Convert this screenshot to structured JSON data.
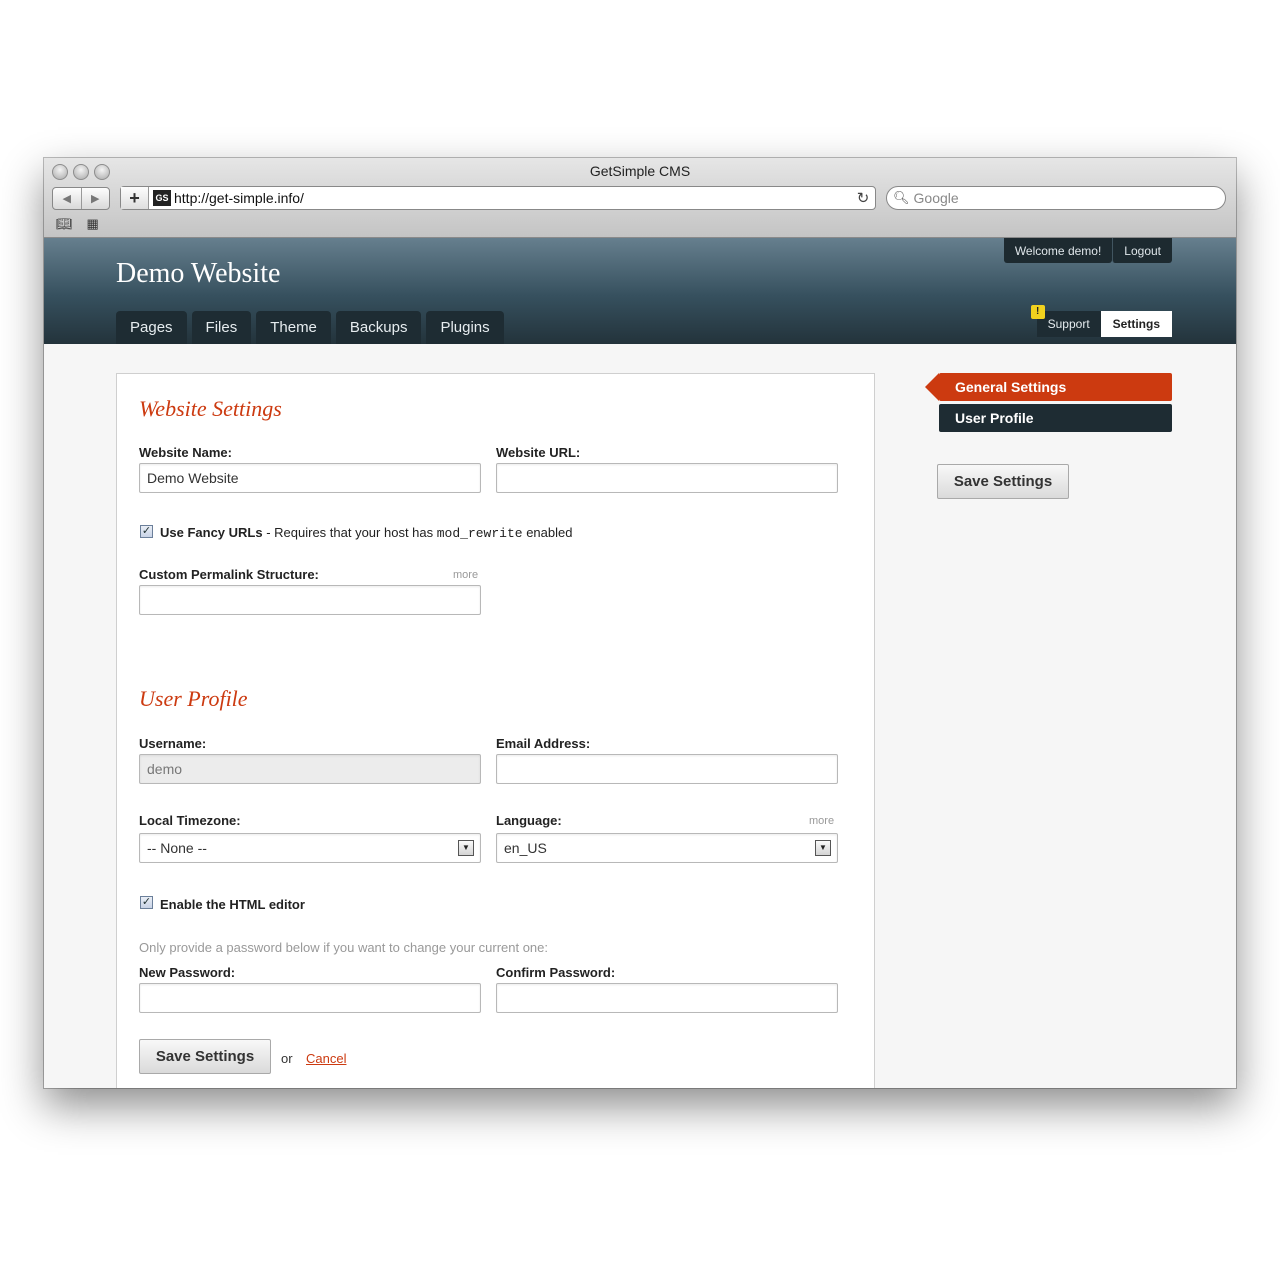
{
  "browser": {
    "window_title": "GetSimple CMS",
    "favicon_text": "GS",
    "url": "http://get-simple.info/",
    "search_placeholder": "Google"
  },
  "site": {
    "title": "Demo Website",
    "welcome": "Welcome demo!",
    "logout": "Logout",
    "tabs": [
      "Pages",
      "Files",
      "Theme",
      "Backups",
      "Plugins"
    ],
    "support": "Support",
    "support_alert": "!",
    "settings": "Settings"
  },
  "sidebar": {
    "items": [
      "General Settings",
      "User Profile"
    ],
    "save_label": "Save Settings"
  },
  "website_settings": {
    "heading": "Website Settings",
    "name_label": "Website Name:",
    "name_value": "Demo Website",
    "url_label": "Website URL:",
    "url_value": "",
    "fancy_label": "Use Fancy URLs",
    "fancy_note_pre": " - Requires that your host has ",
    "fancy_note_code": "mod_rewrite",
    "fancy_note_post": " enabled",
    "permalink_label": "Custom Permalink Structure:",
    "permalink_more": "more",
    "permalink_value": ""
  },
  "user_profile": {
    "heading": "User Profile",
    "username_label": "Username:",
    "username_value": "demo",
    "email_label": "Email Address:",
    "email_value": "",
    "timezone_label": "Local Timezone:",
    "timezone_value": "-- None --",
    "language_label": "Language:",
    "language_more": "more",
    "language_value": "en_US",
    "html_editor_label": "Enable the HTML editor",
    "password_hint": "Only provide a password below if you want to change your current one:",
    "new_password_label": "New Password:",
    "confirm_password_label": "Confirm Password:"
  },
  "actions": {
    "save_label": "Save Settings",
    "or": "or",
    "cancel": "Cancel"
  }
}
